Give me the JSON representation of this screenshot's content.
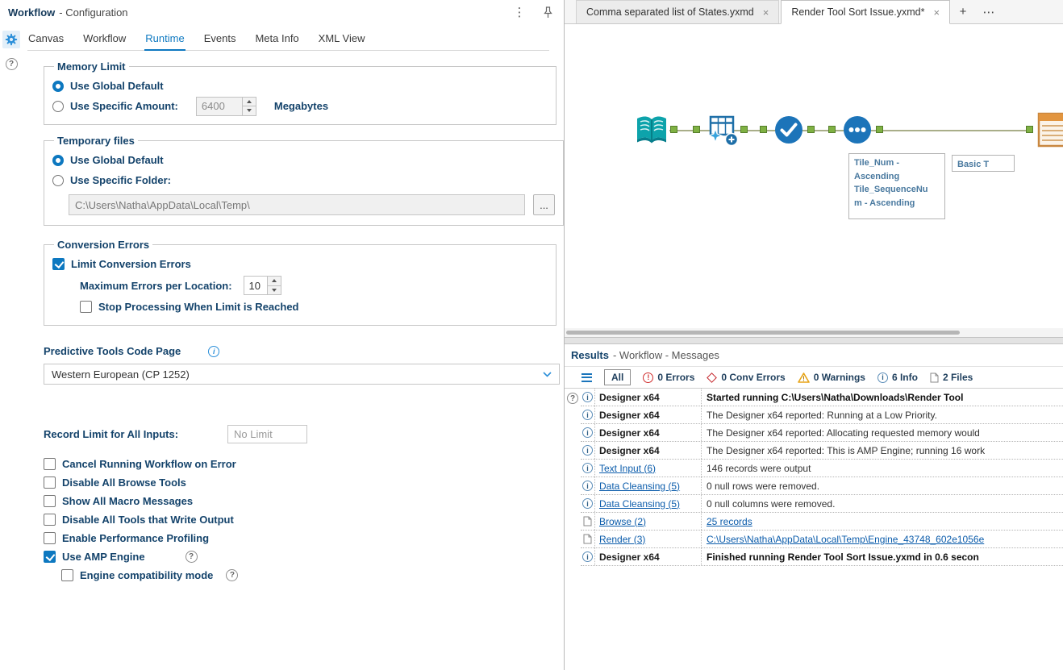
{
  "icons": {
    "kebab": "⋮",
    "close": "×",
    "new_tab": "+",
    "more_tabs": "⋯",
    "help": "?",
    "info_i": "i",
    "error_mark": "!",
    "browse_dots": "..."
  },
  "colors": {
    "accent_blue": "#0d78c0",
    "navy_label": "#14436b",
    "link": "#0b5cab",
    "error_red": "#d02d2d",
    "warning_amber": "#e8a416",
    "anchor_green": "#7fb143",
    "tool_blue": "#1c74b9",
    "tool_teal": "#0da3ab",
    "tool_orange": "#e2953f"
  },
  "config_panel": {
    "title": "Workflow",
    "subtitle": "- Configuration",
    "tabs": [
      "Canvas",
      "Workflow",
      "Runtime",
      "Events",
      "Meta Info",
      "XML View"
    ],
    "active_tab": "Runtime",
    "memory_limit": {
      "legend": "Memory Limit",
      "use_global": "Use Global Default",
      "use_global_checked": true,
      "use_specific": "Use Specific Amount:",
      "use_specific_checked": false,
      "amount": "6400",
      "unit": "Megabytes"
    },
    "temp_files": {
      "legend": "Temporary files",
      "use_global": "Use Global Default",
      "use_global_checked": true,
      "use_specific": "Use Specific Folder:",
      "use_specific_checked": false,
      "folder": "C:\\Users\\Natha\\AppData\\Local\\Temp\\"
    },
    "conversion_errors": {
      "legend": "Conversion Errors",
      "limit_label": "Limit Conversion Errors",
      "limit_checked": true,
      "max_label": "Maximum Errors per Location:",
      "max_value": "10",
      "stop_label": "Stop Processing When Limit is Reached",
      "stop_checked": false
    },
    "code_page": {
      "label": "Predictive Tools Code Page",
      "value": "Western European (CP 1252)"
    },
    "record_limit": {
      "label": "Record Limit for All Inputs:",
      "placeholder": "No Limit"
    },
    "options": [
      {
        "label": "Cancel Running Workflow on Error",
        "checked": false
      },
      {
        "label": "Disable All Browse Tools",
        "checked": false
      },
      {
        "label": "Show All Macro Messages",
        "checked": false
      },
      {
        "label": "Disable All Tools that Write Output",
        "checked": false
      },
      {
        "label": "Enable Performance Profiling",
        "checked": false
      },
      {
        "label": "Use AMP Engine",
        "checked": true
      },
      {
        "label": "Engine compatibility mode",
        "checked": false
      }
    ]
  },
  "canvas": {
    "tabs": [
      {
        "label": "Comma separated list of States.yxmd",
        "active": false
      },
      {
        "label": "Render Tool Sort Issue.yxmd*",
        "active": true
      }
    ],
    "tool_icons": [
      "text-input-tool",
      "data-cleansing-tool",
      "check-tool",
      "sort-tool",
      "basic-table-tool"
    ],
    "annotations": {
      "sort": "Tile_Num -\nAscending\nTile_SequenceNu\nm - Ascending",
      "table": "Basic T"
    }
  },
  "results": {
    "title": "Results",
    "subtitle": "- Workflow - Messages",
    "filters": {
      "all": "All",
      "errors": "0 Errors",
      "conv_errors": "0 Conv Errors",
      "warnings": "0 Warnings",
      "info": "6 Info",
      "files": "2 Files"
    },
    "messages": [
      {
        "icon": "info",
        "source": "Designer x64",
        "text": "Started running C:\\Users\\Natha\\Downloads\\Render Tool",
        "bold": true
      },
      {
        "icon": "info",
        "source": "Designer x64",
        "text": "The Designer x64 reported: Running at a Low Priority.",
        "bold": false
      },
      {
        "icon": "info",
        "source": "Designer x64",
        "text": "The Designer x64 reported: Allocating requested memory would",
        "bold": false
      },
      {
        "icon": "info",
        "source": "Designer x64",
        "text": "The Designer x64 reported: This is AMP Engine; running 16 work",
        "bold": false
      },
      {
        "icon": "info",
        "source": "Text Input (6)",
        "source_link": true,
        "text": "146 records were output",
        "bold": false
      },
      {
        "icon": "info",
        "source": "Data Cleansing (5)",
        "source_link": true,
        "text": "0 null rows were removed.",
        "bold": false
      },
      {
        "icon": "info",
        "source": "Data Cleansing (5)",
        "source_link": true,
        "text": "0 null columns were removed.",
        "bold": false
      },
      {
        "icon": "file",
        "source": "Browse (2)",
        "source_link": true,
        "text": "25 records",
        "text_link": true,
        "bold": false
      },
      {
        "icon": "file",
        "source": "Render (3)",
        "source_link": true,
        "text": "C:\\Users\\Natha\\AppData\\Local\\Temp\\Engine_43748_602e1056e",
        "text_link": true,
        "bold": false
      },
      {
        "icon": "info",
        "source": "Designer x64",
        "text": "Finished running Render Tool Sort Issue.yxmd in 0.6 secon",
        "bold": true
      }
    ]
  }
}
